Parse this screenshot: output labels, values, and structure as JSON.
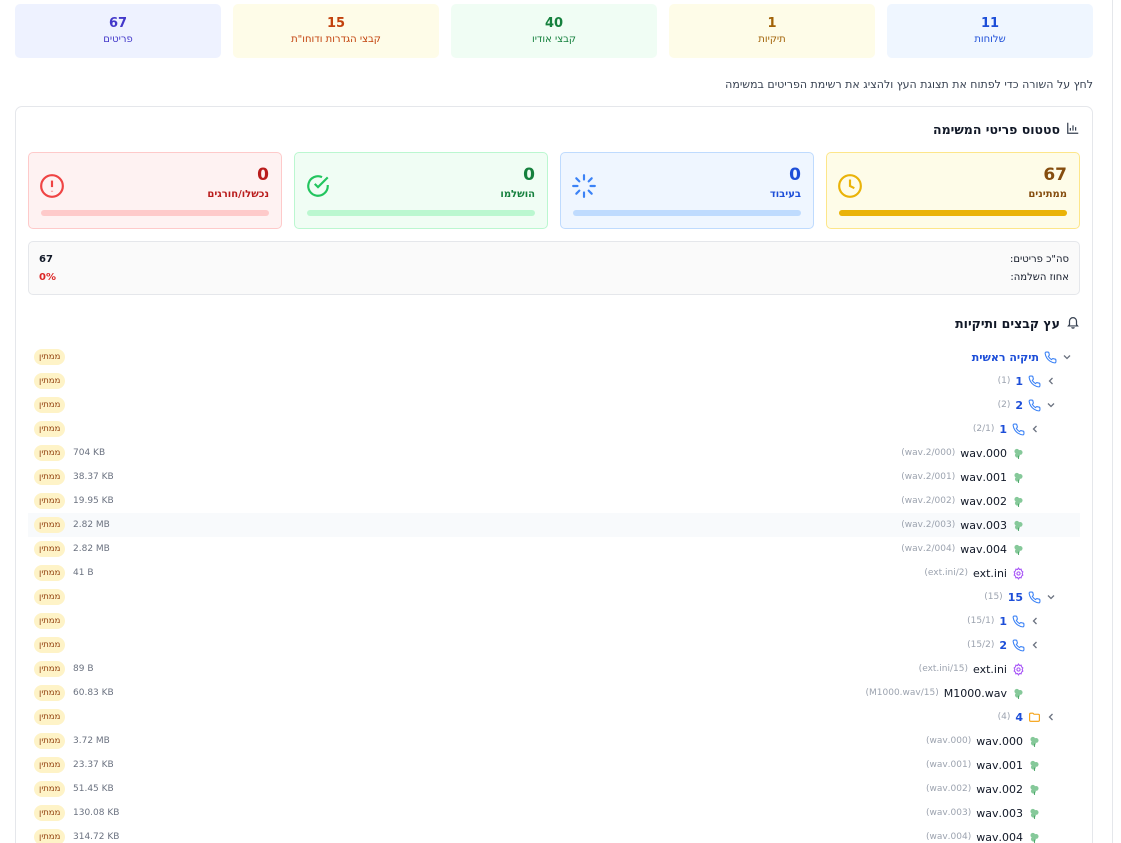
{
  "top_stats": [
    {
      "value": "11",
      "label": "שלוחות",
      "bg": "#eff6ff",
      "color": "#1d4ed8"
    },
    {
      "value": "1",
      "label": "תיקיות",
      "bg": "#fefce8",
      "color": "#a16207"
    },
    {
      "value": "40",
      "label": "קבצי אודיו",
      "bg": "#f0fdf4",
      "color": "#15803d"
    },
    {
      "value": "15",
      "label": "קבצי הגדרות ודוחו\"ת",
      "bg": "#fefce8",
      "color": "#c2410c"
    },
    {
      "value": "67",
      "label": "פריטים",
      "bg": "#eef2ff",
      "color": "#4338ca"
    }
  ],
  "hint": "לחץ על השורה כדי לפתוח את תצוגת העץ ולהציג את רשימת הפריטים במשימה",
  "status_section": {
    "title": "סטטוס פריטי המשימה",
    "cards": [
      {
        "value": "67",
        "label": "ממתינים",
        "icon": "clock-icon",
        "bg": "#fefce8",
        "border": "#fde68a",
        "color": "#854d0e",
        "icon_color": "#eab308",
        "track": "#fde68a",
        "fill_color": "#eab308",
        "progress": 1
      },
      {
        "value": "0",
        "label": "בעיבוד",
        "icon": "spinner-icon",
        "bg": "#eff6ff",
        "border": "#bfdbfe",
        "color": "#1d4ed8",
        "icon_color": "#3b82f6",
        "track": "#bfdbfe",
        "fill_color": "#3b82f6",
        "progress": 0
      },
      {
        "value": "0",
        "label": "הושלמו",
        "icon": "check-circle-icon",
        "bg": "#f0fdf4",
        "border": "#bbf7d0",
        "color": "#15803d",
        "icon_color": "#22c55e",
        "track": "#bbf7d0",
        "fill_color": "#22c55e",
        "progress": 0
      },
      {
        "value": "0",
        "label": "נכשלו/חורגים",
        "icon": "alert-circle-icon",
        "bg": "#fef2f2",
        "border": "#fecaca",
        "color": "#b91c1c",
        "icon_color": "#ef4444",
        "track": "#fecaca",
        "fill_color": "#ef4444",
        "progress": 0
      }
    ],
    "summary": {
      "total_label": "סה\"כ פריטים:",
      "total_value": "67",
      "percent_label": "אחוז השלמה:",
      "percent_value": "0%"
    }
  },
  "tree_section": {
    "title": "עץ קבצים ותיקיות",
    "status_label": "ממתין",
    "rows": [
      {
        "depth": 0,
        "chevron": "down",
        "icon": "phone-icon",
        "name": "תיקיה ראשית",
        "sub": "",
        "size": "",
        "folder": true
      },
      {
        "depth": 1,
        "chevron": "left",
        "icon": "phone-icon",
        "name": "1",
        "sub": "(1)",
        "size": "",
        "folder": true
      },
      {
        "depth": 1,
        "chevron": "down",
        "icon": "phone-icon",
        "name": "2",
        "sub": "(2)",
        "size": "",
        "folder": true
      },
      {
        "depth": 2,
        "chevron": "left",
        "icon": "phone-icon",
        "name": "1",
        "sub": "(2/1)",
        "size": "",
        "folder": true
      },
      {
        "depth": 2,
        "chevron": "",
        "icon": "audio-file-icon",
        "name": "000.wav",
        "sub": "(2/000.wav)",
        "size": "704 KB",
        "folder": false
      },
      {
        "depth": 2,
        "chevron": "",
        "icon": "audio-file-icon",
        "name": "001.wav",
        "sub": "(2/001.wav)",
        "size": "38.37 KB",
        "folder": false
      },
      {
        "depth": 2,
        "chevron": "",
        "icon": "audio-file-icon",
        "name": "002.wav",
        "sub": "(2/002.wav)",
        "size": "19.95 KB",
        "folder": false
      },
      {
        "depth": 2,
        "chevron": "",
        "icon": "audio-file-icon",
        "name": "003.wav",
        "sub": "(2/003.wav)",
        "size": "2.82 MB",
        "folder": false,
        "highlight": true
      },
      {
        "depth": 2,
        "chevron": "",
        "icon": "audio-file-icon",
        "name": "004.wav",
        "sub": "(2/004.wav)",
        "size": "2.82 MB",
        "folder": false
      },
      {
        "depth": 2,
        "chevron": "",
        "icon": "settings-file-icon",
        "name": "ext.ini",
        "sub": "(2/ext.ini)",
        "size": "41 B",
        "folder": false
      },
      {
        "depth": 1,
        "chevron": "down",
        "icon": "phone-icon",
        "name": "15",
        "sub": "(15)",
        "size": "",
        "folder": true
      },
      {
        "depth": 2,
        "chevron": "left",
        "icon": "phone-icon",
        "name": "1",
        "sub": "(15/1)",
        "size": "",
        "folder": true
      },
      {
        "depth": 2,
        "chevron": "left",
        "icon": "phone-icon",
        "name": "2",
        "sub": "(15/2)",
        "size": "",
        "folder": true
      },
      {
        "depth": 2,
        "chevron": "",
        "icon": "settings-file-icon",
        "name": "ext.ini",
        "sub": "(15/ext.ini)",
        "size": "89 B",
        "folder": false
      },
      {
        "depth": 2,
        "chevron": "",
        "icon": "audio-file-icon",
        "name": "M1000.wav",
        "sub": "(15/M1000.wav)",
        "size": "60.83 KB",
        "folder": false
      },
      {
        "depth": 1,
        "chevron": "left",
        "icon": "folder-icon",
        "name": "4",
        "sub": "(4)",
        "size": "",
        "folder": true
      },
      {
        "depth": 1,
        "chevron": "",
        "icon": "audio-file-icon",
        "name": "000.wav",
        "sub": "(000.wav)",
        "size": "3.72 MB",
        "folder": false
      },
      {
        "depth": 1,
        "chevron": "",
        "icon": "audio-file-icon",
        "name": "001.wav",
        "sub": "(001.wav)",
        "size": "23.37 KB",
        "folder": false
      },
      {
        "depth": 1,
        "chevron": "",
        "icon": "audio-file-icon",
        "name": "002.wav",
        "sub": "(002.wav)",
        "size": "51.45 KB",
        "folder": false
      },
      {
        "depth": 1,
        "chevron": "",
        "icon": "audio-file-icon",
        "name": "003.wav",
        "sub": "(003.wav)",
        "size": "130.08 KB",
        "folder": false
      },
      {
        "depth": 1,
        "chevron": "",
        "icon": "audio-file-icon",
        "name": "004.wav",
        "sub": "(004.wav)",
        "size": "314.72 KB",
        "folder": false
      }
    ]
  }
}
